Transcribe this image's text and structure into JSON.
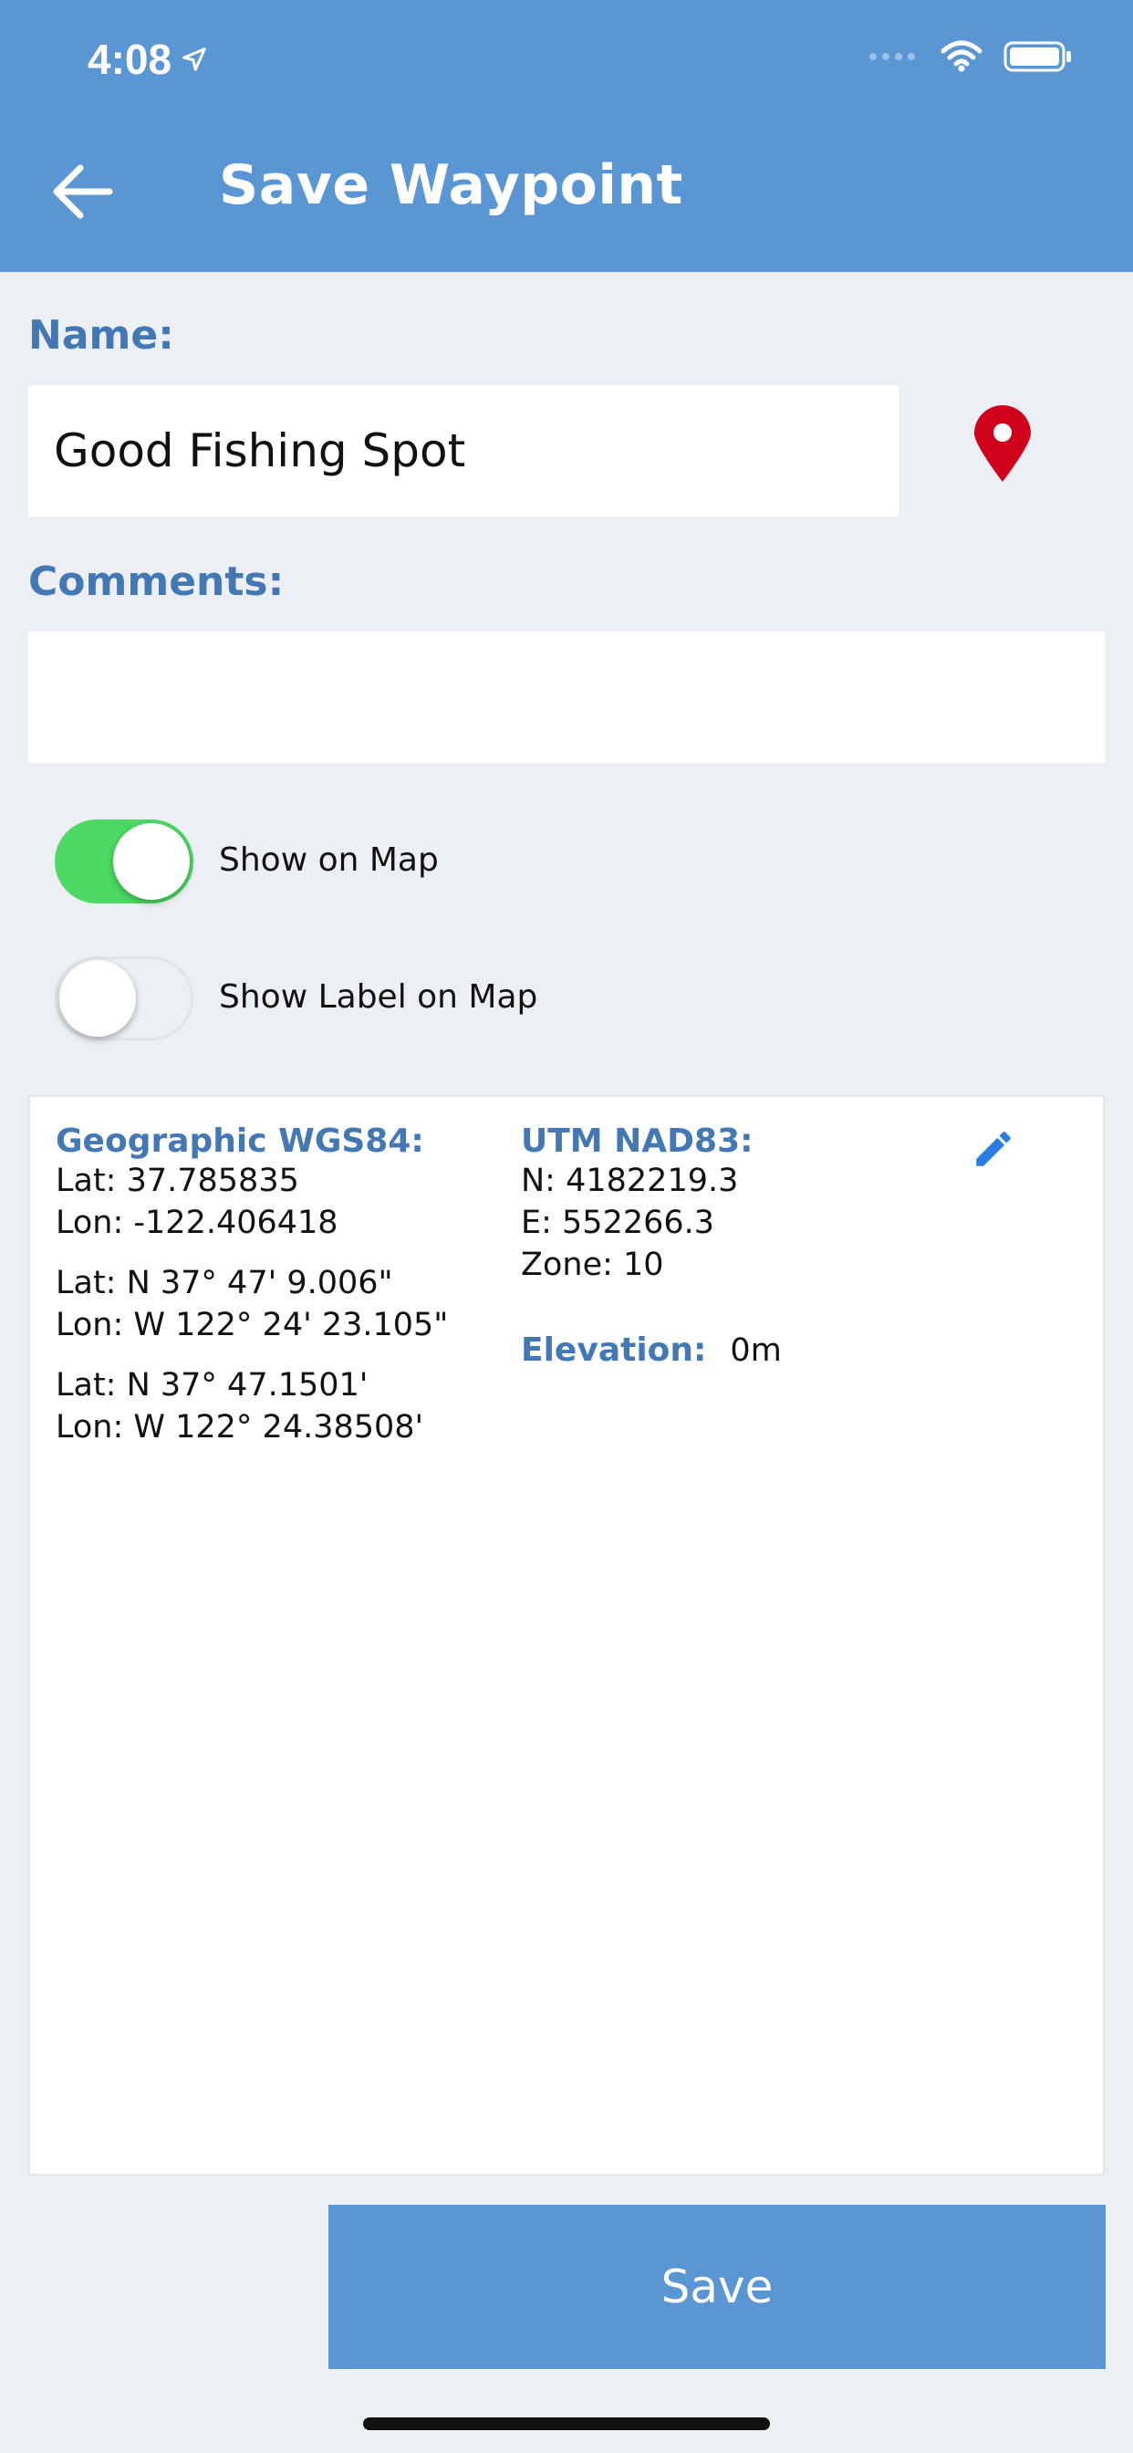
{
  "status_bar": {
    "time": "4:08",
    "icons": [
      "location-arrow-icon",
      "cellular-signal-icon",
      "wifi-icon",
      "battery-icon"
    ]
  },
  "header": {
    "title": "Save Waypoint",
    "back_icon": "arrow-left-icon",
    "color": "#5b96d4"
  },
  "form": {
    "name_label": "Name:",
    "name_value": "Good Fishing Spot",
    "pin_icon": "map-pin-icon",
    "pin_color": "#d0021b",
    "comments_label": "Comments:",
    "comments_value": "",
    "show_on_map": {
      "label": "Show on Map",
      "enabled": true
    },
    "show_label_on_map": {
      "label": "Show Label on Map",
      "enabled": false
    }
  },
  "coordinates": {
    "geographic": {
      "heading": "Geographic WGS84:",
      "decimal": {
        "lat": "Lat: 37.785835",
        "lon": "Lon: -122.406418"
      },
      "dms": {
        "lat": "Lat: N 37° 47' 9.006\"",
        "lon": "Lon: W 122° 24' 23.105\""
      },
      "dm": {
        "lat": "Lat: N 37° 47.1501'",
        "lon": "Lon: W 122° 24.38508'"
      }
    },
    "utm": {
      "heading": "UTM NAD83:",
      "northing": "N: 4182219.3",
      "easting": "E: 552266.3",
      "zone": "Zone: 10"
    },
    "elevation": {
      "label": "Elevation:",
      "value": "0m"
    },
    "edit_icon": "pencil-icon"
  },
  "actions": {
    "save_label": "Save"
  },
  "colors": {
    "accent": "#5b96d4",
    "label_blue": "#4378b5",
    "toggle_on": "#4cd964",
    "background": "#ecf0f4"
  }
}
